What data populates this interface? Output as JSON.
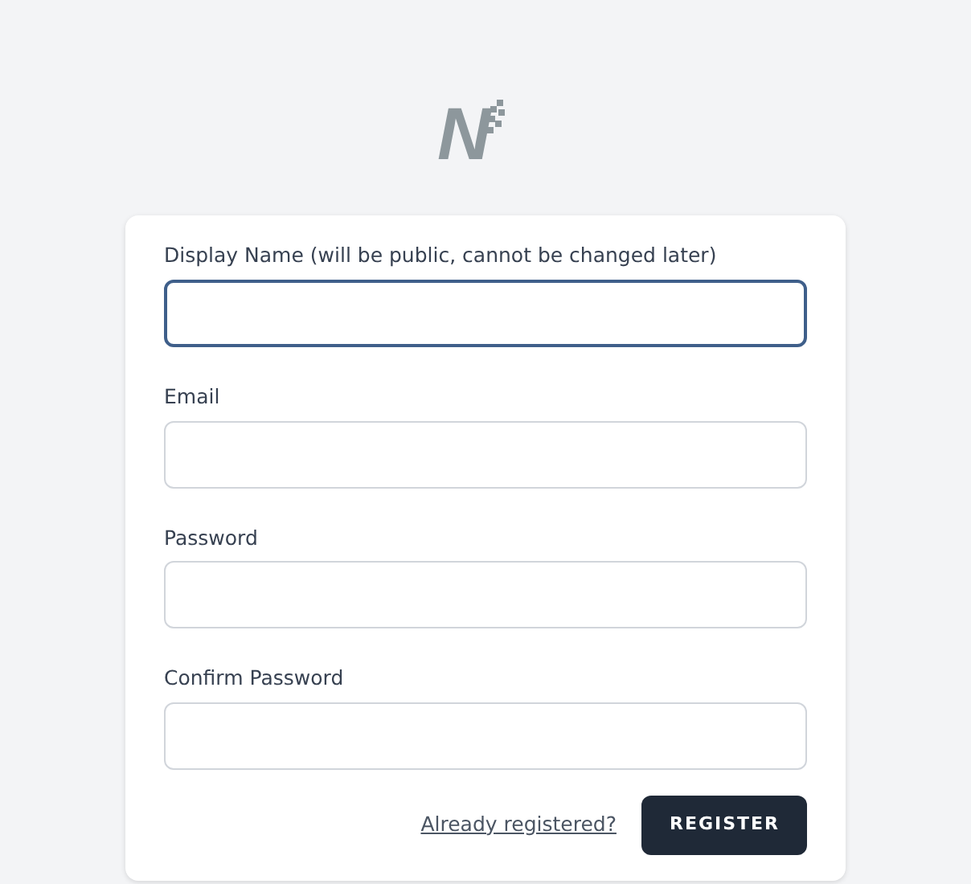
{
  "logo": {
    "text": "N"
  },
  "fields": [
    {
      "label": "Display Name (will be public, cannot be changed later)",
      "focused": true
    },
    {
      "label": "Email",
      "focused": false
    },
    {
      "label": "Password",
      "focused": false
    },
    {
      "label": "Confirm Password",
      "focused": false
    }
  ],
  "link": "Already registered?",
  "button": "REGISTER"
}
